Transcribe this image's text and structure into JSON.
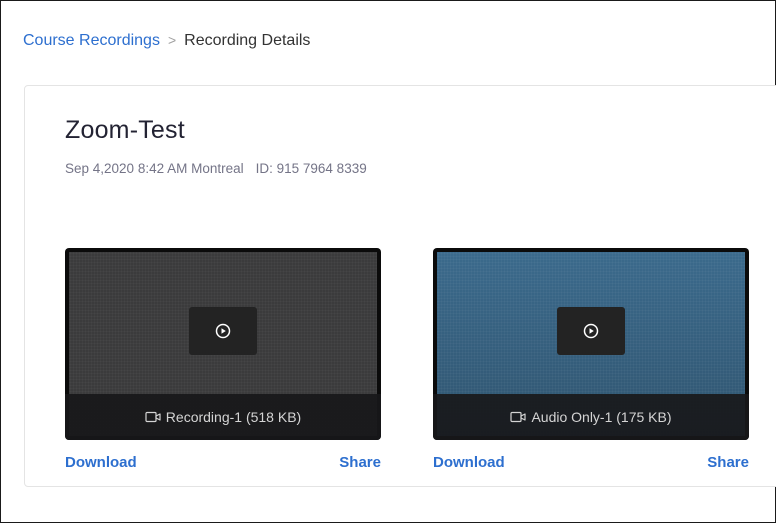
{
  "breadcrumb": {
    "parent": "Course Recordings",
    "separator": ">",
    "current": "Recording Details"
  },
  "meeting": {
    "title": "Zoom-Test",
    "datetime": "Sep 4,2020 8:42 AM Montreal",
    "id": "ID: 915 7964 8339"
  },
  "recordings": [
    {
      "name": "Recording-1 (518 KB)",
      "thumbnail_style": "gray",
      "download_label": "Download",
      "share_label": "Share"
    },
    {
      "name": "Audio Only-1 (175 KB)",
      "thumbnail_style": "blue",
      "download_label": "Download",
      "share_label": "Share"
    }
  ],
  "icons": {
    "play": "play-circle-icon",
    "file": "video-camera-icon"
  },
  "colors": {
    "link": "#2d6fcf",
    "text_primary": "#232333",
    "text_secondary": "#747487",
    "thumb_gray": "#3b3b3c",
    "thumb_blue": "#3f6a86"
  }
}
